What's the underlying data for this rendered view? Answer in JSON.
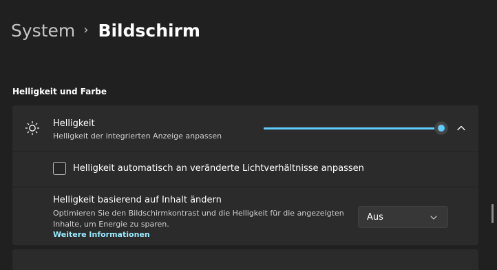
{
  "breadcrumb": {
    "parent": "System",
    "separator": "›",
    "current": "Bildschirm"
  },
  "section": {
    "title": "Helligkeit und Farbe"
  },
  "brightness": {
    "icon": "sun-icon",
    "title": "Helligkeit",
    "subtitle": "Helligkeit der integrierten Anzeige anpassen",
    "level_percent": 100,
    "accent_color": "#60cdff",
    "expanded": true
  },
  "auto_brightness": {
    "checked": false,
    "label": "Helligkeit automatisch an veränderte Lichtverhältnisse anpassen"
  },
  "content_adaptive": {
    "title": "Helligkeit basierend auf Inhalt ändern",
    "description": "Optimieren Sie den Bildschirmkontrast und die Helligkeit für die angezeigten Inhalte, um Energie zu sparen.",
    "link": "Weitere Informationen",
    "dropdown_value": "Aus",
    "link_color": "#99ebff"
  },
  "theme": {
    "background": "#202020",
    "card": "#2b2b2b"
  }
}
